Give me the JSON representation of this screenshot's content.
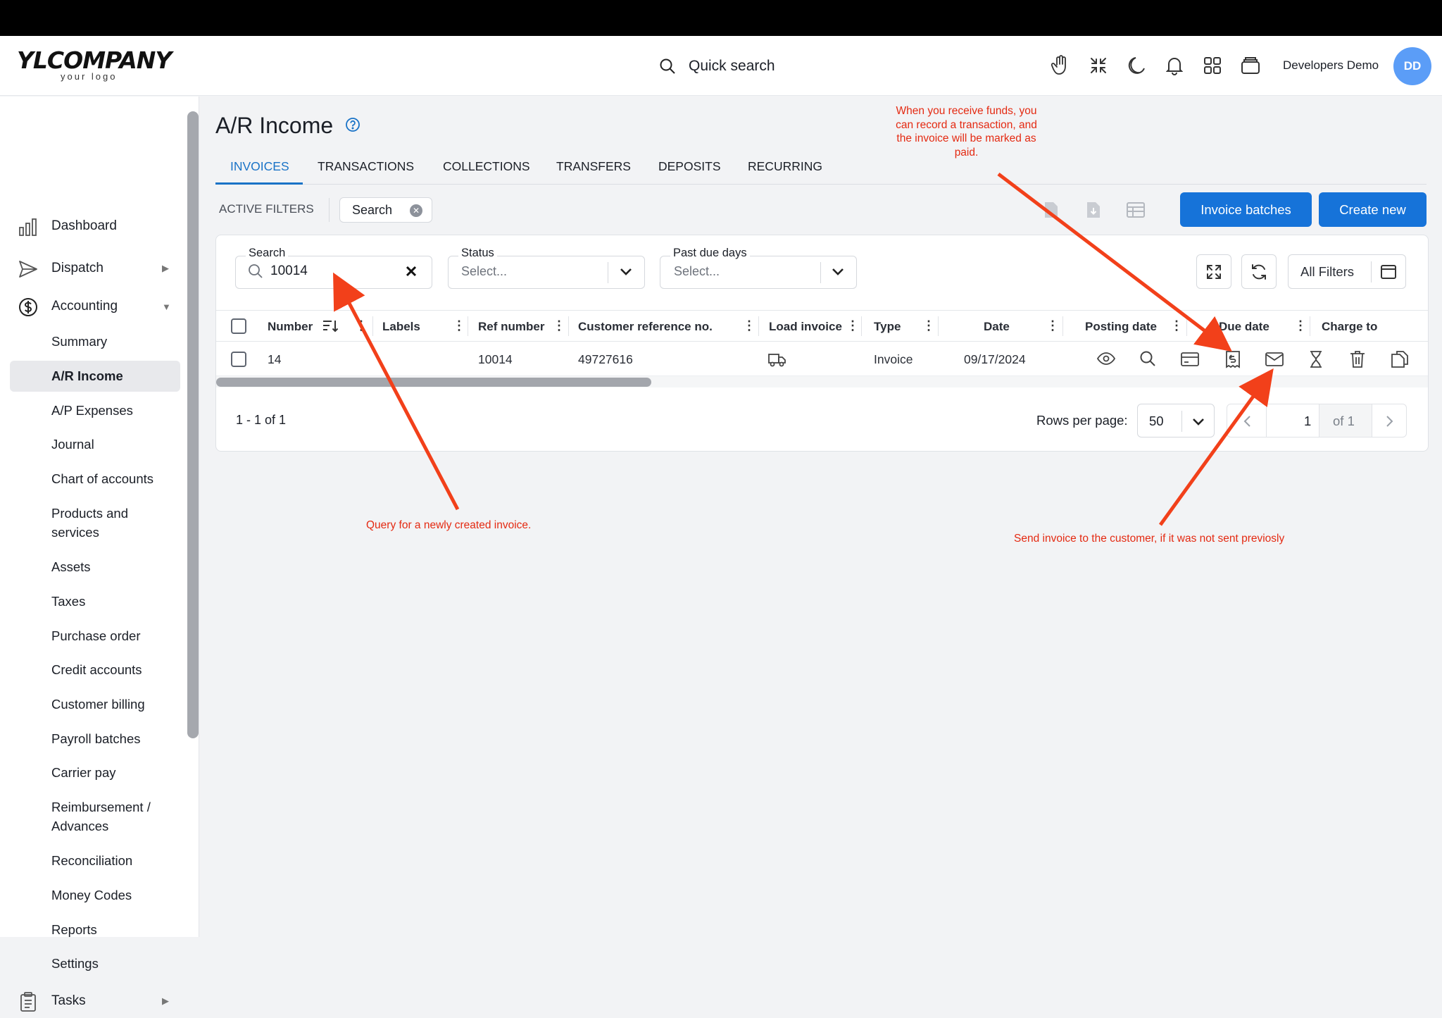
{
  "header": {
    "logo_main": "YLCOMPANY",
    "logo_sub": "your logo",
    "quick_search": "Quick search",
    "user_name": "Developers Demo",
    "avatar_initials": "DD"
  },
  "sidebar": {
    "top_items": [
      {
        "label": "Dashboard",
        "icon": "bar-chart-icon"
      },
      {
        "label": "Dispatch",
        "icon": "paper-plane-icon"
      },
      {
        "label": "Accounting",
        "icon": "dollar-circle-icon"
      }
    ],
    "sub_items": [
      "Summary",
      "A/R Income",
      "A/P Expenses",
      "Journal",
      "Chart of accounts",
      "Products and services",
      "Assets",
      "Taxes",
      "Purchase order",
      "Credit accounts",
      "Customer billing",
      "Payroll batches",
      "Carrier pay",
      "Reimbursement / Advances",
      "Reconciliation",
      "Money Codes",
      "Reports",
      "Settings"
    ],
    "active": "A/R Income",
    "bottom_item": {
      "label": "Tasks",
      "icon": "clipboard-icon"
    }
  },
  "page": {
    "title": "A/R Income",
    "tabs": [
      "INVOICES",
      "TRANSACTIONS",
      "COLLECTIONS",
      "TRANSFERS",
      "DEPOSITS",
      "RECURRING"
    ],
    "active_tab": "INVOICES",
    "active_filters_label": "ACTIVE FILTERS",
    "filter_chip": "Search",
    "invoice_batches": "Invoice batches",
    "create_new": "Create new"
  },
  "filters": {
    "search_label": "Search",
    "search_value": "10014",
    "status_label": "Status",
    "status_placeholder": "Select...",
    "past_due_label": "Past due days",
    "past_due_placeholder": "Select...",
    "all_filters": "All Filters"
  },
  "table": {
    "columns": [
      "Number",
      "Labels",
      "Ref number",
      "Customer reference no.",
      "Load invoice",
      "Type",
      "Date",
      "Posting date",
      "Due date",
      "Charge to"
    ],
    "rows": [
      {
        "number": "14",
        "labels": "",
        "ref_number": "10014",
        "customer_ref": "49727616",
        "type": "Invoice",
        "date": "09/17/2024"
      }
    ]
  },
  "pagination": {
    "range": "1 - 1 of 1",
    "rows_per_page_label": "Rows per page:",
    "rows_per_page": "50",
    "page": "1",
    "of_pages": "of 1"
  },
  "annotations": {
    "top_note": "When you receive funds, you can record a transaction, and the invoice will be marked as paid.",
    "query_note": "Query for a newly created invoice.",
    "send_note": "Send invoice to the customer, if it was not sent previosly"
  },
  "colors": {
    "accent": "#1673d9",
    "annotation": "#e42a12",
    "avatar": "#5b9df7"
  }
}
